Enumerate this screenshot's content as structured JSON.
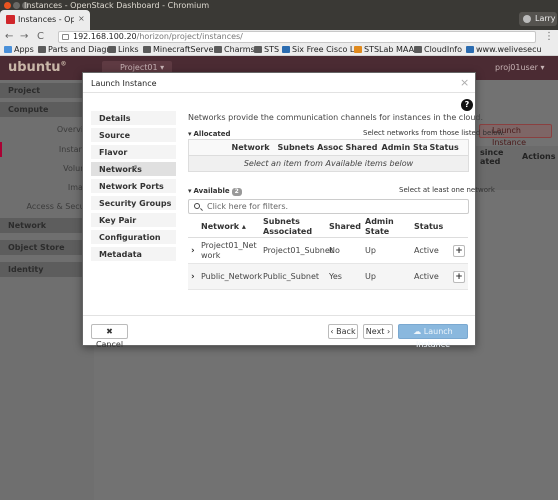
{
  "browser": {
    "tab_title": "Instances - OpenSt",
    "tab_close": "×",
    "window_title": "Instances - OpenStack Dashboard - Chromium",
    "user_name": "Larry",
    "url_host": "192.168.100.20",
    "url_path": "/horizon/project/instances/",
    "nav_back": "←",
    "nav_forward": "→",
    "nav_reload": "C",
    "menu": "⋮",
    "bookmarks": [
      "Apps",
      "Parts and Diagra",
      "Links",
      "MinecraftServer",
      "Charms",
      "STS",
      "Six Free Cisco La",
      "STSLab MAAS",
      "CloudInfo",
      "www.welivesecu"
    ]
  },
  "dashboard": {
    "logo": "ubuntu",
    "logo_mark": "®",
    "project_selector": "Project01 ▾",
    "user_menu": "proj01user ▾",
    "sidebar": [
      {
        "label": "Project",
        "kind": "bold"
      },
      {
        "label": "Compute",
        "kind": "bold"
      },
      {
        "label": "Overvie",
        "kind": "sub"
      },
      {
        "label": "Instanc",
        "kind": "sub"
      },
      {
        "label": "Volum",
        "kind": "sub"
      },
      {
        "label": "Imag",
        "kind": "sub"
      },
      {
        "label": "Access & Secur",
        "kind": "sub"
      },
      {
        "label": "Network",
        "kind": "bold"
      },
      {
        "label": "Object Store",
        "kind": "bold"
      },
      {
        "label": "Identity",
        "kind": "bold"
      }
    ],
    "bg_launch": "Launch Instance",
    "bg_since": "since\nated",
    "bg_actions": "Actions"
  },
  "modal": {
    "title": "Launch Instance",
    "close": "×",
    "help": "?",
    "steps": [
      "Details",
      "Source",
      "Flavor",
      "Networks",
      "Network Ports",
      "Security Groups",
      "Key Pair",
      "Configuration",
      "Metadata"
    ],
    "active_step": "Networks",
    "description": "Networks provide the communication channels for instances in the cloud.",
    "allocated": {
      "heading": "Allocated",
      "hint": "Select networks from those listed below.",
      "columns": [
        "Network",
        "Subnets Associated",
        "Shared",
        "Admin State",
        "Status"
      ],
      "empty_text": "Select an item from Available items below"
    },
    "available": {
      "heading": "Available",
      "count": "2",
      "hint": "Select at least one network",
      "filter_placeholder": "Click here for filters.",
      "columns": [
        "Network ▴",
        "Subnets Associated",
        "Shared",
        "Admin State",
        "Status"
      ],
      "rows": [
        {
          "network": "Project01_Network",
          "subnets": "Project01_Subnet",
          "shared": "No",
          "admin": "Up",
          "status": "Active"
        },
        {
          "network": "Public_Network",
          "subnets": "Public_Subnet",
          "shared": "Yes",
          "admin": "Up",
          "status": "Active"
        }
      ]
    },
    "footer": {
      "cancel": "✖ Cancel",
      "back": "‹ Back",
      "next": "Next ›",
      "launch": "Launch Instance"
    }
  }
}
